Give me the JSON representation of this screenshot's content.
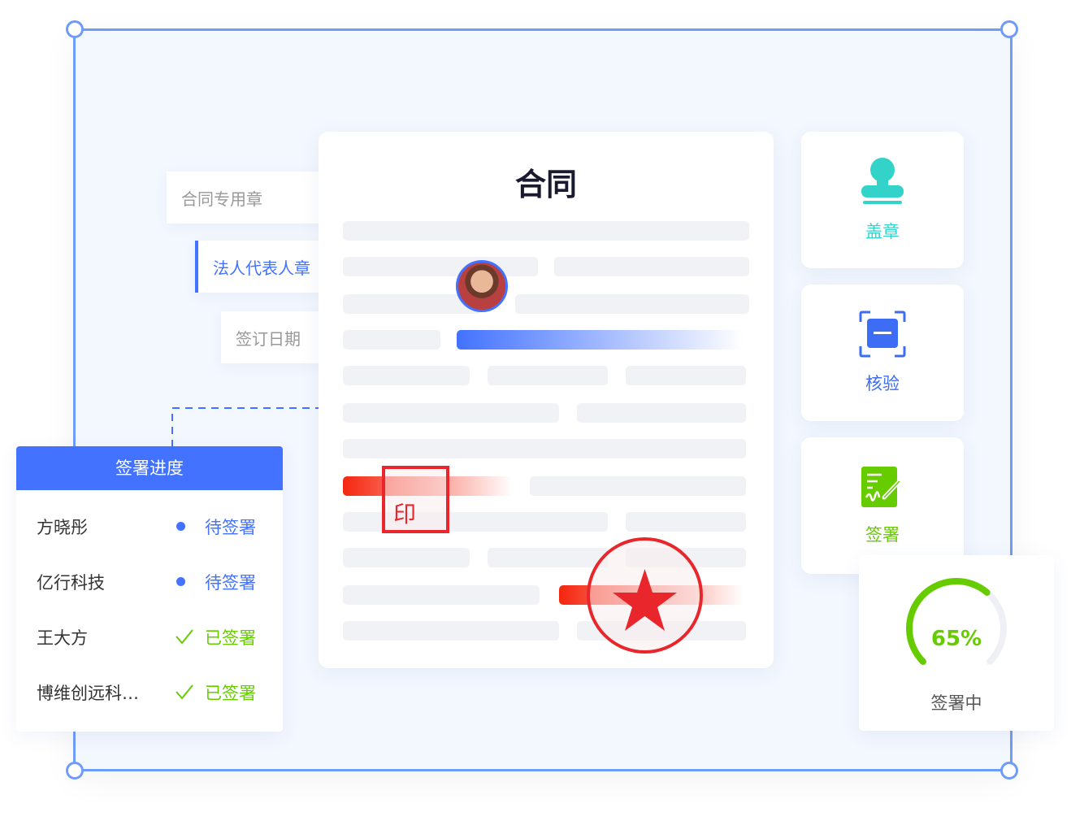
{
  "contract": {
    "title": "合同"
  },
  "tabs": [
    {
      "label": "合同专用章"
    },
    {
      "label": "法人代表人章"
    },
    {
      "label": "签订日期"
    }
  ],
  "seal": {
    "label": "印"
  },
  "tools": [
    {
      "label": "盖章",
      "icon": "stamp-icon",
      "color": "#34d3c9"
    },
    {
      "label": "核验",
      "icon": "scan-verify-icon",
      "color": "#3d6cf5"
    },
    {
      "label": "签署",
      "icon": "signature-icon",
      "color": "#66cc00"
    }
  ],
  "progress_panel": {
    "title": "签署进度",
    "rows": [
      {
        "name": "方晓彤",
        "status": "待签署",
        "state": "pending"
      },
      {
        "name": "亿行科技",
        "status": "待签署",
        "state": "pending"
      },
      {
        "name": "王大方",
        "status": "已签署",
        "state": "done"
      },
      {
        "name": "博维创远科…",
        "status": "已签署",
        "state": "done"
      }
    ]
  },
  "gauge": {
    "value_label": "65%",
    "value": 65,
    "caption": "签署中"
  },
  "colors": {
    "accent": "#4272ff",
    "green": "#66cc00",
    "red": "#e8262b",
    "teal": "#34d3c9"
  }
}
